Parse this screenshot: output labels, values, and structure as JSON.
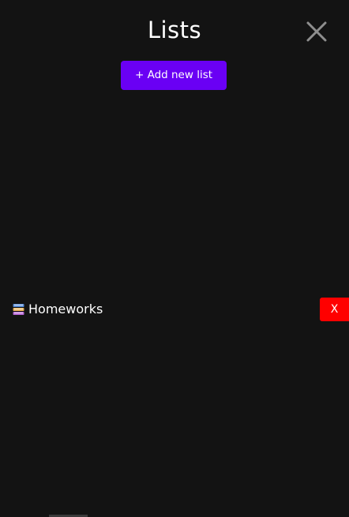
{
  "header": {
    "title": "Lists",
    "close_icon": "close-icon"
  },
  "toolbar": {
    "add_label": "+ Add new list"
  },
  "lists": [
    {
      "icon": "books-icon",
      "name": "Homeworks",
      "delete_label": "X"
    }
  ],
  "colors": {
    "background": "#131313",
    "accent": "#6a00f4",
    "danger": "#ff0000",
    "text": "#ffffff",
    "close_icon": "#8e8e8e"
  }
}
